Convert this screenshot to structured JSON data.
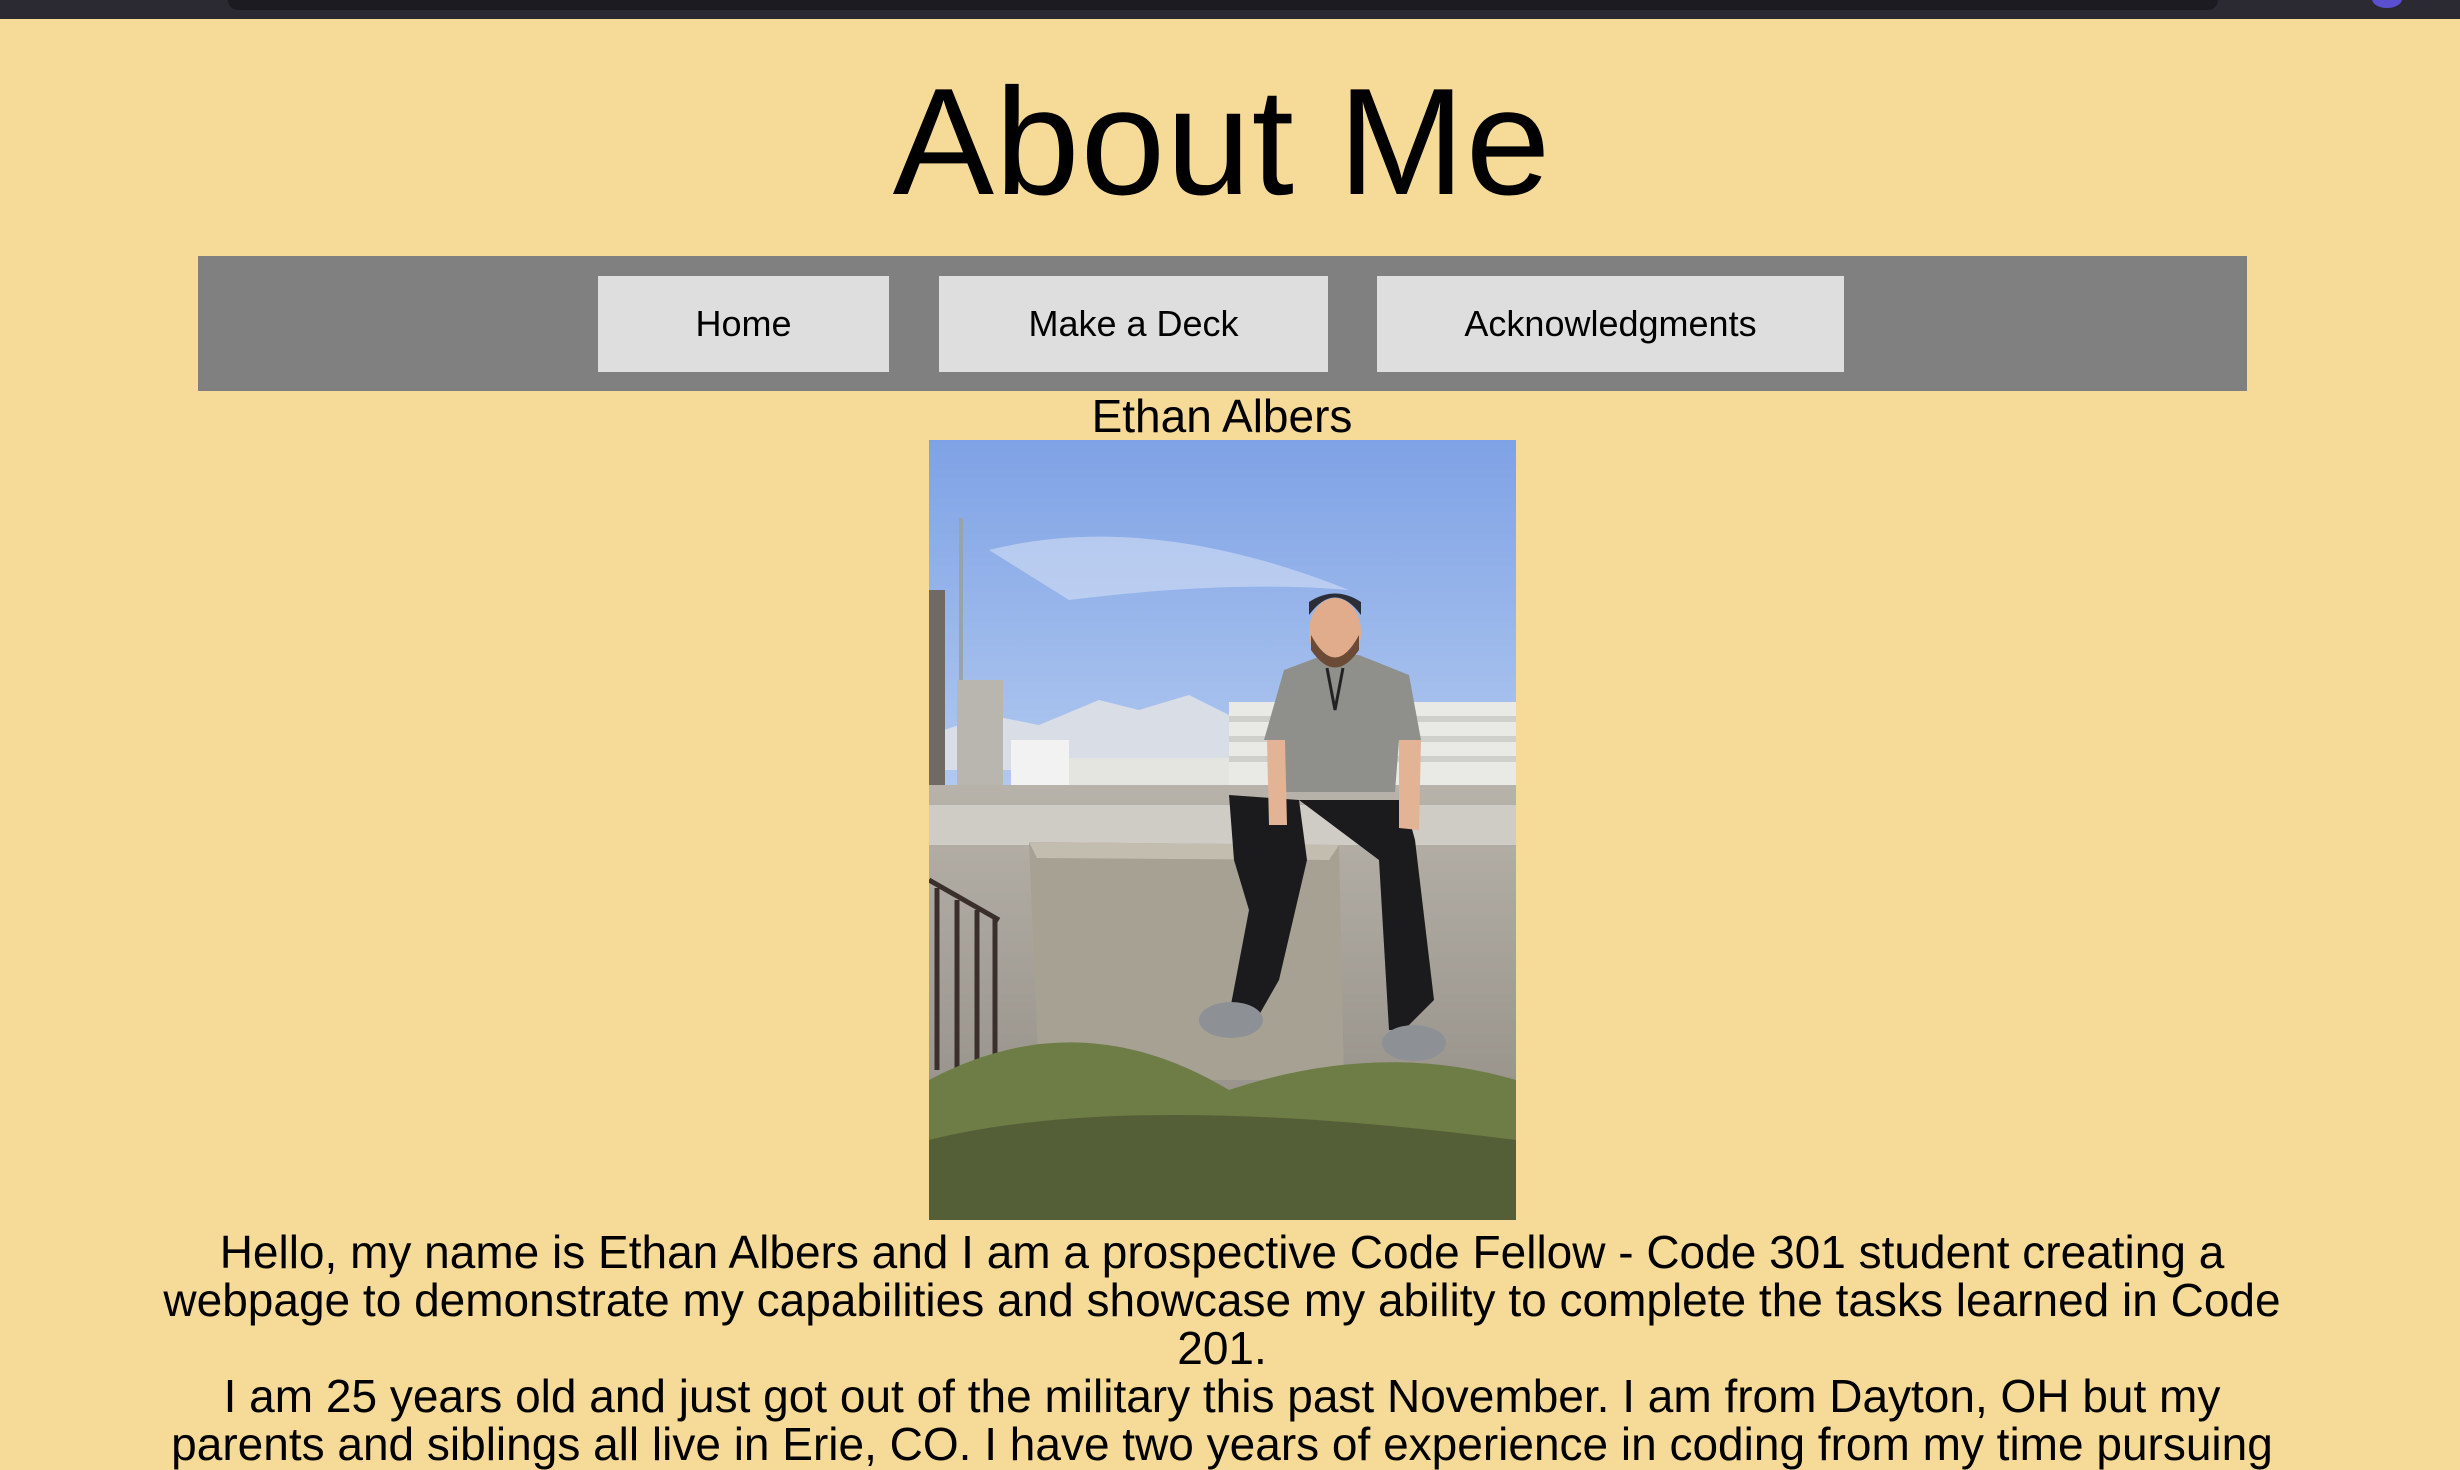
{
  "page": {
    "title": "About Me",
    "background": "#f6da98"
  },
  "nav": {
    "background": "#808080",
    "button_background": "#dedede",
    "items": [
      {
        "label": "Home"
      },
      {
        "label": "Make a Deck"
      },
      {
        "label": "Acknowledgments"
      }
    ]
  },
  "profile": {
    "name": "Ethan Albers",
    "photo_icon": "profile-photo"
  },
  "bio": {
    "paragraph_1": "Hello, my name is Ethan Albers and I am a prospective Code Fellow - Code 301 student creating a webpage to demonstrate my capabilities and showcase my ability to complete the tasks learned in Code 201.",
    "paragraph_2": "I am 25 years old and just got out of the military this past November. I am from Dayton, OH but my parents and siblings all live in Erie, CO. I have two years of experience in coding from my time pursuing"
  }
}
